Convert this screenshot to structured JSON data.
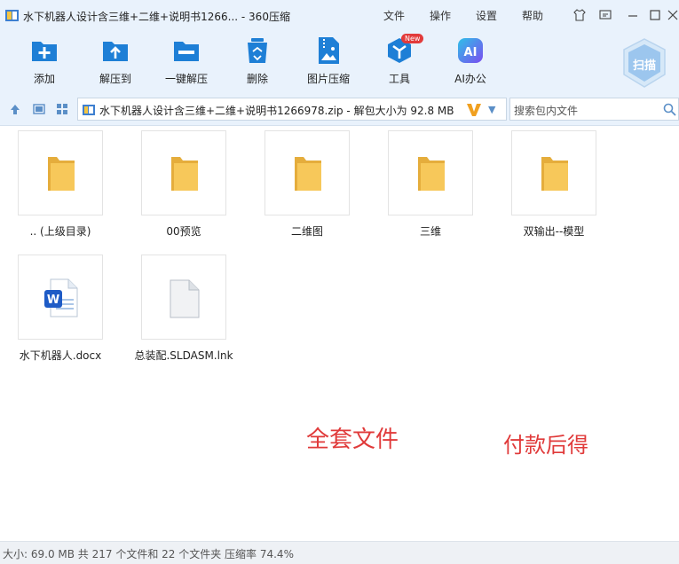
{
  "window": {
    "title": "水下机器人设计含三维+二维+说明书1266... - 360压缩",
    "menu": [
      "文件",
      "操作",
      "设置",
      "帮助"
    ]
  },
  "toolbar": {
    "tools": [
      {
        "label": "添加",
        "icon": "add-icon"
      },
      {
        "label": "解压到",
        "icon": "extract-to-icon"
      },
      {
        "label": "一键解压",
        "icon": "one-click-extract-icon"
      },
      {
        "label": "删除",
        "icon": "delete-icon"
      },
      {
        "label": "图片压缩",
        "icon": "image-compress-icon"
      },
      {
        "label": "工具",
        "icon": "tools-icon",
        "badge": "New"
      },
      {
        "label": "AI办公",
        "icon": "ai-office-icon"
      }
    ],
    "scan_label": "扫描"
  },
  "address": {
    "path": "水下机器人设计含三维+二维+说明书1266978.zip - 解包大小为 92.8 MB"
  },
  "search": {
    "placeholder": "搜索包内文件"
  },
  "files": [
    {
      "name": ".. (上级目录)",
      "type": "folder"
    },
    {
      "name": "00预览",
      "type": "folder"
    },
    {
      "name": "二维图",
      "type": "folder"
    },
    {
      "name": "三维",
      "type": "folder"
    },
    {
      "name": "双输出--模型",
      "type": "folder"
    },
    {
      "name": "水下机器人.docx",
      "type": "docx"
    },
    {
      "name": "总装配.SLDASM.lnk",
      "type": "file"
    }
  ],
  "overlay": {
    "text1": "全套文件",
    "text2": "付款后得"
  },
  "status": {
    "text": "大小: 69.0 MB 共 217 个文件和 22 个文件夹 压缩率 74.4%"
  },
  "colors": {
    "accent": "#1e7fd6",
    "chrome_bg": "#e9f2fc",
    "overlay_red": "#e03a3a",
    "folder_yellow": "#f7c85a"
  }
}
